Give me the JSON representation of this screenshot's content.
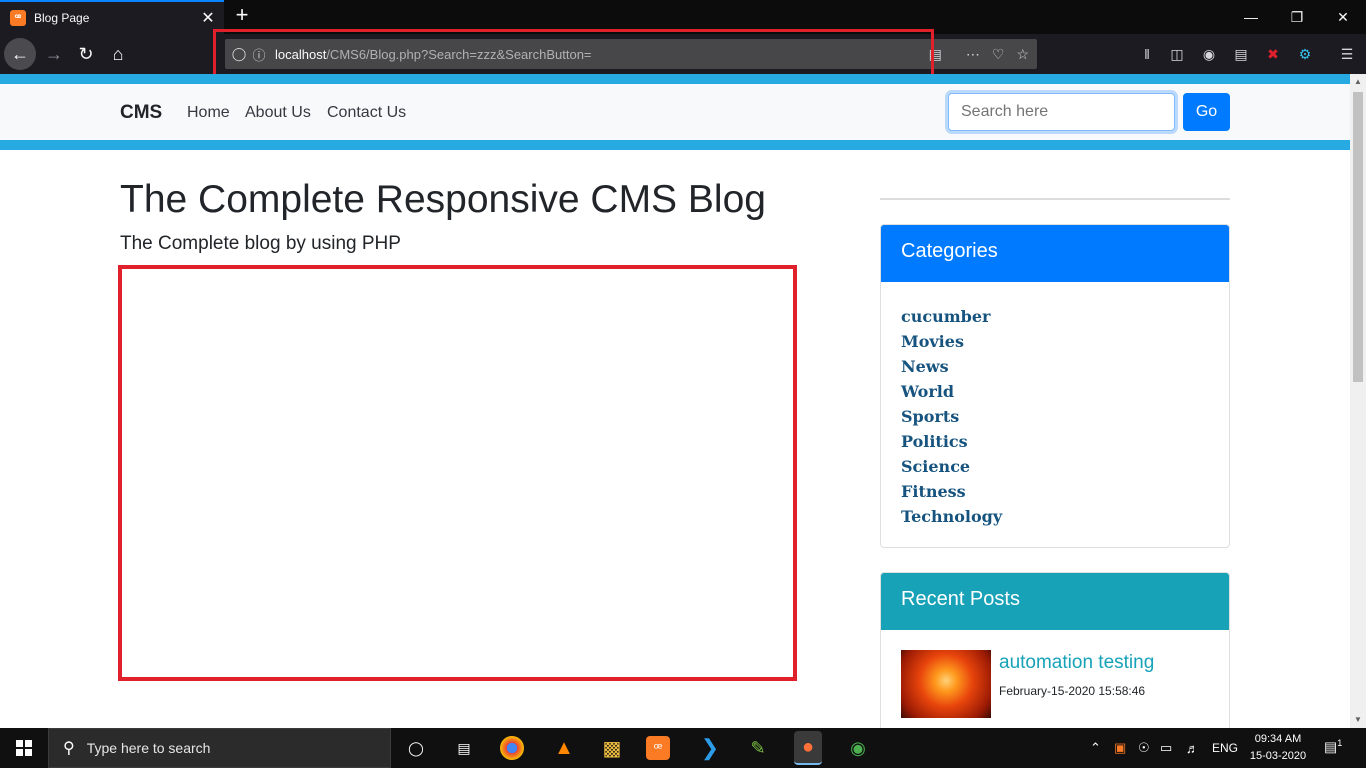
{
  "browser": {
    "tab_title": "Blog Page",
    "tab_favicon": "xampp-icon",
    "url_host": "localhost",
    "url_path": "/CMS6/Blog.php?Search=zzz&SearchButton=",
    "window_controls": [
      "minimize-icon",
      "restore-icon",
      "close-icon"
    ]
  },
  "site": {
    "brand": "CMS",
    "nav": [
      "Home",
      "About Us",
      "Contact Us"
    ],
    "search_placeholder": "Search here",
    "go_label": "Go"
  },
  "main": {
    "title": "The Complete Responsive CMS Blog",
    "lead": "The Complete blog by using PHP"
  },
  "sidebar": {
    "categories_title": "Categories",
    "categories": [
      "cucumber",
      "Movies",
      "News",
      "World",
      "Sports",
      "Politics",
      "Science",
      "Fitness",
      "Technology"
    ],
    "recent_title": "Recent Posts",
    "recent_posts": [
      {
        "title": "automation testing",
        "date": "February-15-2020 15:58:46"
      }
    ]
  },
  "taskbar": {
    "search_placeholder": "Type here to search",
    "language": "ENG",
    "time": "09:34 AM",
    "date": "15-03-2020",
    "notification_count": "1"
  },
  "colors": {
    "accent_band": "#27aae1",
    "primary": "#007bff",
    "info": "#17a2b8",
    "highlight": "#e0202a"
  }
}
